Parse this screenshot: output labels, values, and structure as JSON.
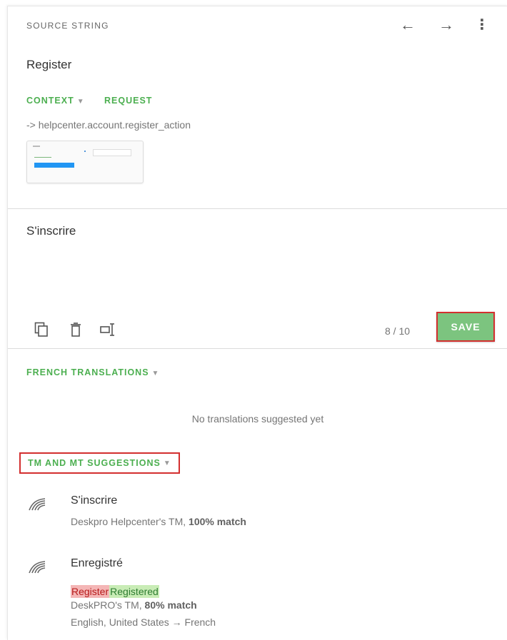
{
  "source": {
    "header": "SOURCE STRING",
    "text": "Register",
    "nav": {
      "prev_icon": "←",
      "next_icon": "→",
      "more_icon": "⋮"
    },
    "context_tab": "CONTEXT",
    "request_tab": "REQUEST",
    "context_key": "-> helpcenter.account.register_action"
  },
  "editor": {
    "translation": "S'inscrire",
    "counter": "8 / 10",
    "save_label": "SAVE"
  },
  "french_translations": {
    "title": "FRENCH TRANSLATIONS",
    "empty": "No translations suggested yet"
  },
  "tm_suggestions": {
    "title": "TM AND MT SUGGESTIONS",
    "items": [
      {
        "text": "S'inscrire",
        "source_name": "Deskpro Helpcenter's TM, ",
        "match": "100% match"
      },
      {
        "text": "Enregistré",
        "diff_removed": "Register",
        "diff_added": "Registered",
        "source_name": "DeskPRO's TM, ",
        "match": "80% match",
        "languages": "English, United States → French"
      }
    ]
  },
  "colors": {
    "accent": "#4caf50",
    "save": "#7cc47f",
    "highlight_border": "#d32f2f"
  }
}
